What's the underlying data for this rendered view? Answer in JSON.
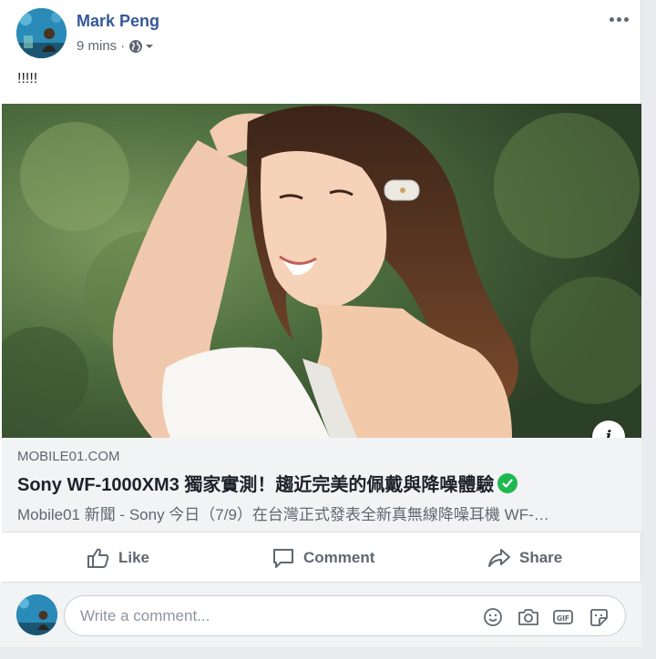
{
  "post": {
    "author": "Mark Peng",
    "time": "9 mins",
    "separator": "·",
    "text": "!!!!!"
  },
  "link_preview": {
    "domain": "MOBILE01.COM",
    "title": "Sony WF-1000XM3 獨家實測！趨近完美的佩戴與降噪體驗",
    "description": "Mobile01 新聞 - Sony 今日（7/9）在台灣正式發表全新真無線降噪耳機 WF-…"
  },
  "actions": {
    "like": "Like",
    "comment": "Comment",
    "share": "Share"
  },
  "comment_box": {
    "placeholder": "Write a comment..."
  },
  "icons": {
    "more": "more-options-icon",
    "audience": "globe-icon",
    "info": "info-icon",
    "verified": "verified-check-icon",
    "like": "thumbs-up-icon",
    "comment": "speech-bubble-icon",
    "share": "share-arrow-icon",
    "emoji": "smiley-icon",
    "camera": "camera-icon",
    "gif": "gif-icon",
    "sticker": "sticker-icon"
  },
  "colors": {
    "author_link": "#365899",
    "secondary_text": "#606770",
    "verified": "#1fb84f",
    "link_box_bg": "#f2f3f5"
  }
}
